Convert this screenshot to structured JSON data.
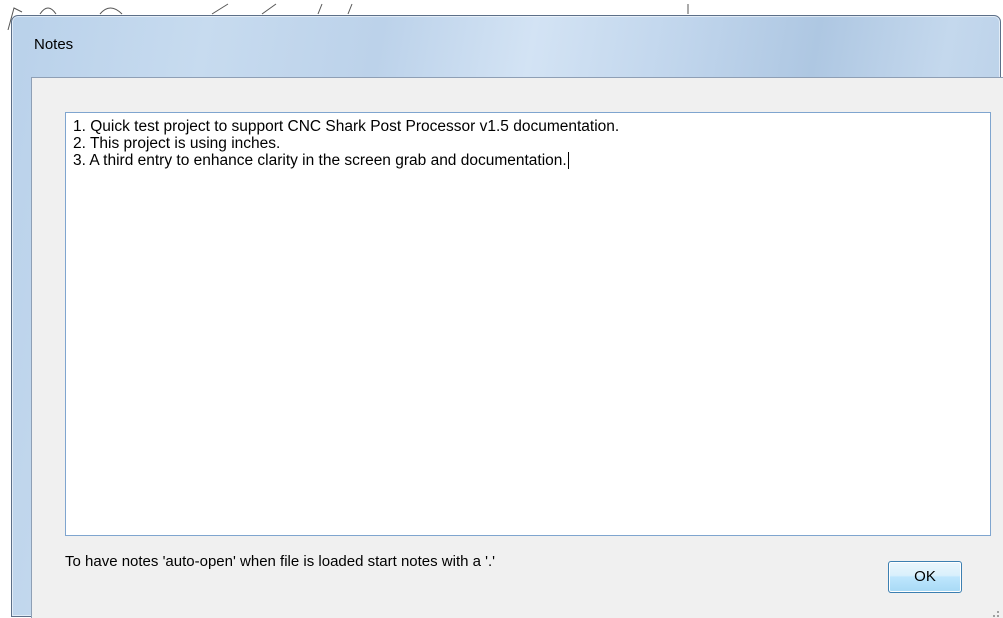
{
  "dialog": {
    "title": "Notes",
    "notes_lines": [
      "1. Quick test project to support CNC Shark Post Processor v1.5 documentation.",
      "2. This project is using inches.",
      "3. A third entry to enhance clarity in the screen grab and documentation."
    ],
    "hint": "To have notes 'auto-open' when file is loaded start notes with a '.'",
    "ok_label": "OK"
  },
  "colors": {
    "frame_border": "#5c6f88",
    "title_bar": "#c7dbef",
    "client_background": "#f0f0f0",
    "textbox_border": "#7fa5cf",
    "button_border": "#3c7fb1"
  },
  "icons": {
    "resize_grip": "resize-grip-icon"
  }
}
